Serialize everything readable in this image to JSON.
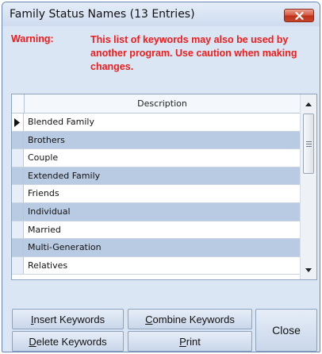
{
  "window": {
    "title": "Family Status Names (13 Entries)",
    "close_icon": "close-icon"
  },
  "warning": {
    "label": "Warning:",
    "text": "This list of keywords may also be used by another program. Use caution when making changes.",
    "color": "#ee1c1c"
  },
  "list": {
    "column_header": "Description",
    "current_row_indicator": "row-pointer-icon",
    "rows": [
      "Blended Family",
      "Brothers",
      "Couple",
      "Extended Family",
      "Friends",
      "Individual",
      "Married",
      "Multi-Generation",
      "Relatives"
    ],
    "alt_row_color": "#b9cbe2"
  },
  "buttons": {
    "insert": {
      "pre": "",
      "key": "I",
      "post": "nsert Keywords"
    },
    "combine": {
      "pre": "",
      "key": "C",
      "post": "ombine Keywords"
    },
    "delete": {
      "pre": "",
      "key": "D",
      "post": "elete Keywords"
    },
    "print": {
      "pre": "",
      "key": "P",
      "post": "rint"
    },
    "close": "Close"
  }
}
